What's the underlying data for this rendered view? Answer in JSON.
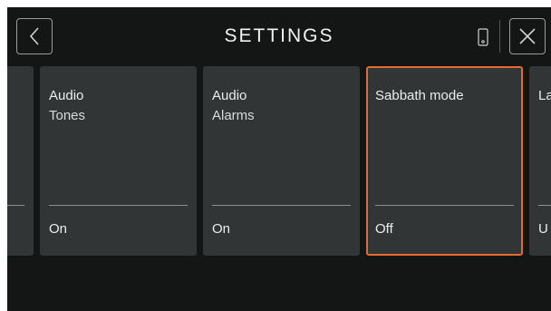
{
  "header": {
    "title": "SETTINGS",
    "back_icon": "chevron-left-icon",
    "device_icon": "phone-icon",
    "close_icon": "close-icon"
  },
  "cards": [
    {
      "line1": "",
      "line2": "",
      "value": ""
    },
    {
      "line1": "Audio",
      "line2": "Tones",
      "value": "On"
    },
    {
      "line1": "Audio",
      "line2": "Alarms",
      "value": "On"
    },
    {
      "line1": "Sabbath mode",
      "line2": "",
      "value": "Off",
      "selected": true
    },
    {
      "line1": "La",
      "line2": "",
      "value": "U"
    }
  ],
  "colors": {
    "background": "#141515",
    "card": "#323535",
    "accent": "#e8692d",
    "text": "#ededed"
  }
}
